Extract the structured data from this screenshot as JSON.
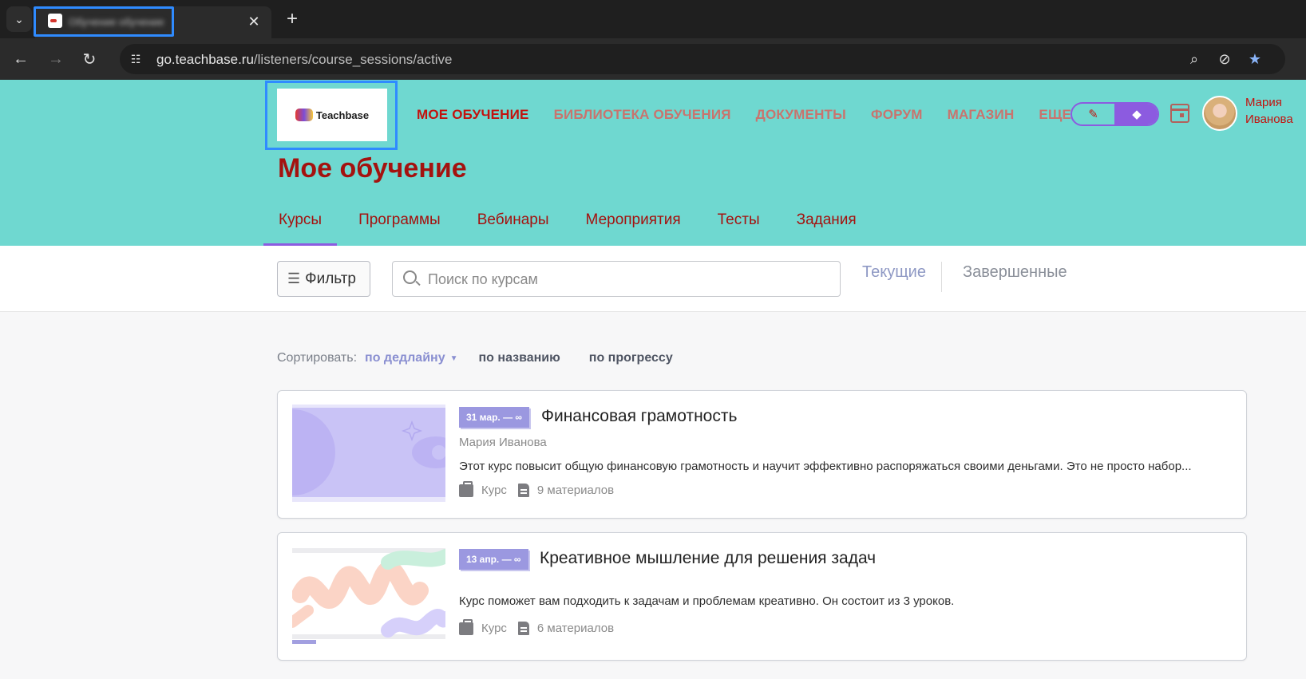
{
  "browser": {
    "tab_title": "Обучение обучение",
    "url_host": "go.teachbase.ru",
    "url_path": "/listeners/course_sessions/active",
    "icons": [
      "tab-menu-icon",
      "close-icon",
      "plus-icon",
      "back-icon",
      "forward-icon",
      "reload-icon",
      "site-info-icon",
      "zoom-icon",
      "eye-off-icon",
      "star-icon"
    ]
  },
  "header": {
    "logo_text": "Teachbase",
    "nav": [
      "МОЕ ОБУЧЕНИЕ",
      "БИБЛИОТЕКА ОБУЧЕНИЯ",
      "ДОКУМЕНТЫ",
      "ФОРУМ",
      "МАГАЗИН",
      "ЕЩЕ"
    ],
    "mode_icons": [
      "pencil-icon",
      "graduation-cap-icon"
    ],
    "user_first": "Мария",
    "user_last": "Иванова",
    "accent_color": "#c3120e",
    "header_bg": "#6fd8d0",
    "toggle_color": "#8c5be0"
  },
  "page": {
    "title": "Мое обучение",
    "tabs": [
      "Курсы",
      "Программы",
      "Вебинары",
      "Мероприятия",
      "Тесты",
      "Задания"
    ],
    "active_tab": "Курсы"
  },
  "filter": {
    "button_label": "Фильтр",
    "search_placeholder": "Поиск по курсам",
    "segment_current": "Текущие",
    "segment_done": "Завершенные"
  },
  "sort": {
    "label": "Сортировать:",
    "options": [
      "по дедлайну",
      "по названию",
      "по прогрессу"
    ],
    "active": "по дедлайну"
  },
  "courses": [
    {
      "badge": "31 мар. — ∞",
      "title": "Финансовая грамотность",
      "author": "Мария Иванова",
      "description": "Этот курс повысит общую финансовую грамотность и научит эффективно распоряжаться своими деньгами. Это не просто набор...",
      "type": "Курс",
      "materials": "9 материалов"
    },
    {
      "badge": "13 апр. — ∞",
      "title": "Креативное мышление для решения задач",
      "author": "",
      "description": "Курс поможет вам подходить к задачам и проблемам креативно. Он состоит из 3 уроков.",
      "type": "Курс",
      "materials": "6 материалов"
    }
  ]
}
